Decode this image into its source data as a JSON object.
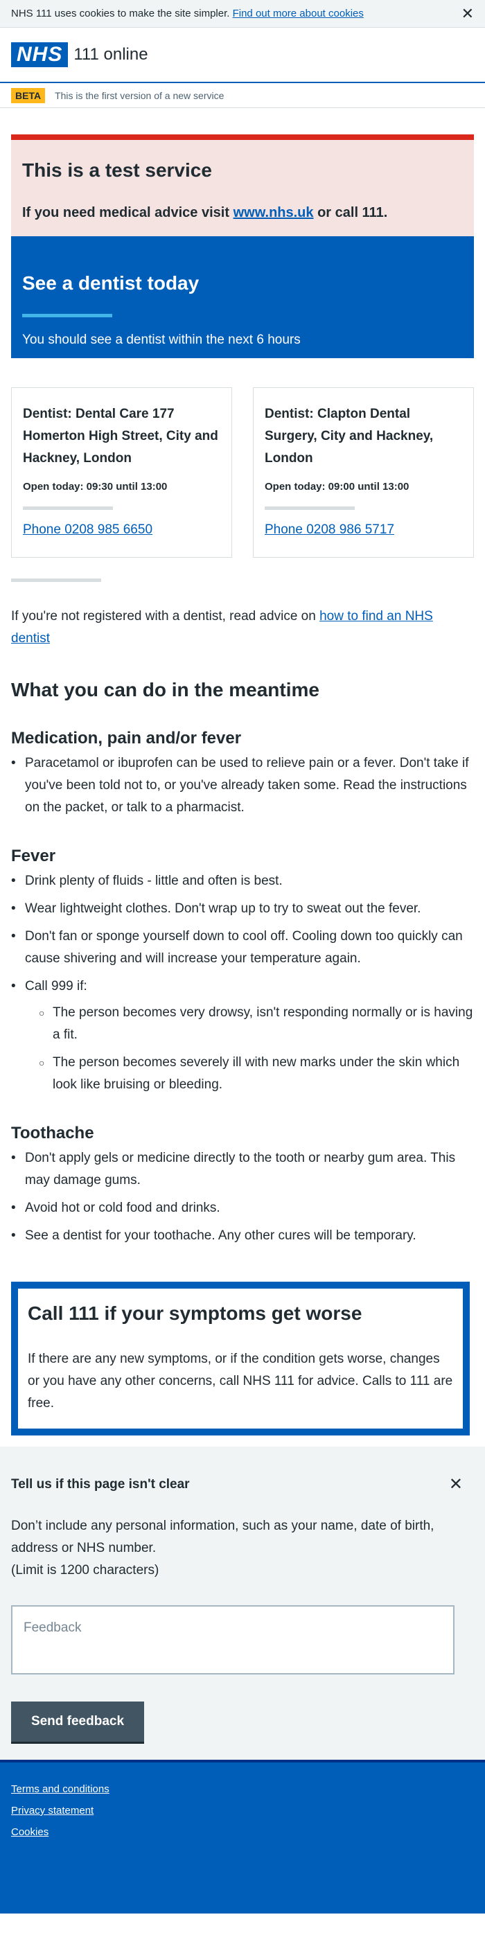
{
  "cookie_banner": {
    "text": "NHS 111 uses cookies to make the site simpler.",
    "link": "Find out more about cookies",
    "close_glyph": "✕"
  },
  "header": {
    "logo": "NHS",
    "service_name": "111 online"
  },
  "beta_banner": {
    "tag": "BETA",
    "text": "This is the first version of a new service"
  },
  "test_notice": {
    "title": "This is a test service",
    "text_before": "If you need medical advice visit",
    "link": "www.nhs.uk",
    "text_after": "or call 111."
  },
  "care_card": {
    "title": "See a dentist today",
    "subtitle": "You should see a dentist within the next 6 hours"
  },
  "services": [
    {
      "name": "Dentist: Dental Care 177 Homerton High Street, City and Hackney, London",
      "opening": "Open today: 09:30 until 13:00",
      "phone": "Phone 0208 985 6650"
    },
    {
      "name": "Dentist: Clapton Dental Surgery, City and Hackney, London",
      "opening": "Open today: 09:00 until 13:00",
      "phone": "Phone 0208 986 5717"
    }
  ],
  "register_advice": {
    "text": "If you're not registered with a dentist, read advice on",
    "link": "how to find an NHS dentist"
  },
  "meantime": {
    "title": "What you can do in the meantime",
    "medication": {
      "title": "Medication, pain and/or fever",
      "items": [
        "Paracetamol or ibuprofen can be used to relieve pain or a fever. Don't take if you've been told not to, or you've already taken some. Read the instructions on the packet, or talk to a pharmacist."
      ]
    },
    "fever": {
      "title": "Fever",
      "items": [
        "Drink plenty of fluids - little and often is best.",
        "Wear lightweight clothes. Don't wrap up to try to sweat out the fever.",
        "Don't fan or sponge yourself down to cool off. Cooling down too quickly can cause shivering and will increase your temperature again.",
        "Call 999 if:"
      ],
      "call_999_items": [
        "The person becomes very drowsy, isn't responding normally or is having a fit.",
        "The person becomes severely ill with new marks under the skin which look like bruising or bleeding."
      ]
    },
    "toothache": {
      "title": "Toothache",
      "items": [
        "Don't apply gels or medicine directly to the tooth or nearby gum area. This may damage gums.",
        "Avoid hot or cold food and drinks.",
        "See a dentist for your toothache. Any other cures will be temporary."
      ]
    }
  },
  "worse": {
    "title": "Call 111 if your symptoms get worse",
    "text": "If there are any new symptoms, or if the condition gets worse, changes or you have any other concerns, call NHS 111 for advice. Calls to 111 are free."
  },
  "feedback": {
    "title": "Tell us if this page isn't clear",
    "close_glyph": "✕",
    "instructions": "Don’t include any personal information, such as your name, date of birth, address or NHS number.",
    "limit": "(Limit is 1200 characters)",
    "placeholder": "Feedback",
    "button": "Send feedback"
  },
  "footer": {
    "links": [
      "Terms and conditions",
      "Privacy statement",
      "Cookies"
    ]
  },
  "colors": {
    "nhs_blue": "#005eb8",
    "emergency_red": "#da291c",
    "beta_yellow": "#ffb81c"
  }
}
